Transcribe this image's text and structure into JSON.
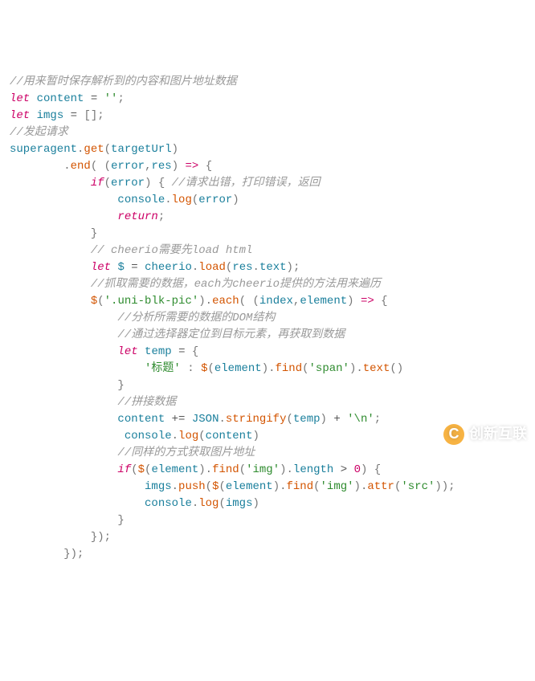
{
  "code": {
    "c1": "//用来暂时保存解析到的内容和图片地址数据",
    "kw_let": "let",
    "id_content": "content",
    "eq": "=",
    "str_empty": "''",
    "semi": ";",
    "id_imgs": "imgs",
    "arr_empty": "[]",
    "c2": "//发起请求",
    "id_superagent": "superagent",
    "dot": ".",
    "fn_get": "get",
    "lp": "(",
    "rp": ")",
    "id_targetUrl": "targetUrl",
    "fn_end": "end",
    "lp2": "( (",
    "id_error": "error",
    "comma": ",",
    "id_res": "res",
    "rp_arrow": ") ",
    "arrow": "=>",
    "lb": " {",
    "kw_if": "if",
    "c3": " //请求出错，打印错误，返回",
    "id_console": "console",
    "fn_log": "log",
    "kw_return": "return",
    "rb": "}",
    "c4": "// cheerio需要先load html",
    "id_dollar": "$",
    "id_cheerio": "cheerio",
    "fn_load": "load",
    "id_text": "text",
    "c5": "//抓取需要的数据，each为cheerio提供的方法用来遍历",
    "fn_dollar": "$",
    "str_selector": "'.uni-blk-pic'",
    "fn_each": "each",
    "id_index": "index",
    "id_element": "element",
    "c6": "//分析所需要的数据的DOM结构",
    "c7": "//通过选择器定位到目标元素，再获取到数据",
    "id_temp": "temp",
    "str_title": "'标题'",
    "colon": " : ",
    "fn_find": "find",
    "str_span": "'span'",
    "fn_text": "text",
    "c8": "//拼接数据",
    "pluseq": "+=",
    "id_JSON": "JSON",
    "fn_stringify": "stringify",
    "plus": " + ",
    "str_nl": "'\\n'",
    "c9": "//同样的方式获取图片地址",
    "str_img": "'img'",
    "id_length": "length",
    "gt": " > ",
    "num0": "0",
    "fn_push": "push",
    "fn_attr": "attr",
    "str_src": "'src'",
    "close_paren_semi": ");",
    "close_brace_paren_semi": "});"
  },
  "watermark": {
    "icon_letter": "C",
    "text": "创新互联"
  }
}
